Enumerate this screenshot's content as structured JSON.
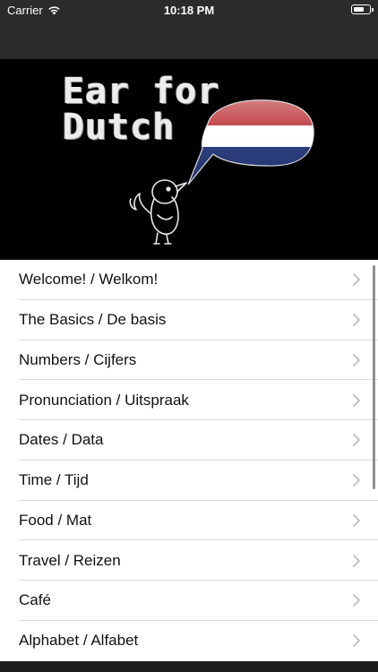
{
  "status_bar": {
    "carrier": "Carrier",
    "time": "10:18 PM",
    "battery_level": 0.7
  },
  "banner": {
    "title_line1": "Ear for",
    "title_line2": "Dutch",
    "flag_colors": [
      "#b8252b",
      "#ffffff",
      "#1e3175"
    ]
  },
  "menu": {
    "items": [
      {
        "label": "Welcome! / Welkom!"
      },
      {
        "label": "The Basics / De basis"
      },
      {
        "label": "Numbers / Cijfers"
      },
      {
        "label": "Pronunciation / Uitspraak"
      },
      {
        "label": "Dates / Data"
      },
      {
        "label": "Time / Tijd"
      },
      {
        "label": "Food / Mat"
      },
      {
        "label": "Travel / Reizen"
      },
      {
        "label": "Café"
      },
      {
        "label": "Alphabet / Alfabet"
      }
    ]
  }
}
